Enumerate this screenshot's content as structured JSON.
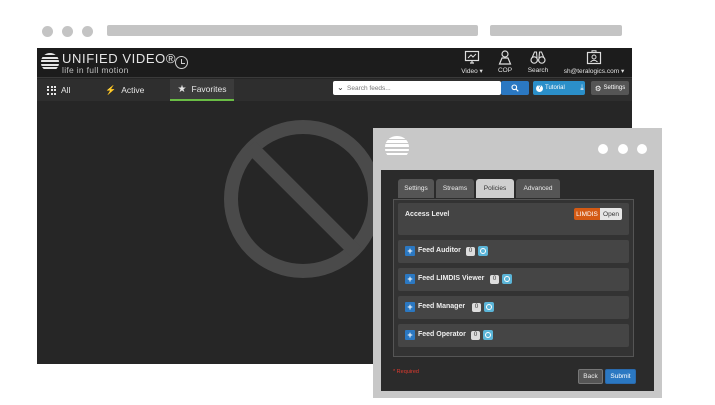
{
  "app": {
    "brand_title": "UNIFIED VIDEO®",
    "brand_tagline": "life in full motion",
    "nav": [
      {
        "label": "Video",
        "icon": "monitor-icon",
        "caret": "▾"
      },
      {
        "label": "COP",
        "icon": "person-icon",
        "caret": ""
      },
      {
        "label": "Search",
        "icon": "binoculars-icon",
        "caret": ""
      },
      {
        "label": "sh@teralogics.com",
        "icon": "user-badge-icon",
        "caret": "▾"
      }
    ],
    "tabs": [
      {
        "label": "All",
        "icon": "grid-icon"
      },
      {
        "label": "Active",
        "icon": "bolt-icon"
      },
      {
        "label": "Favorites",
        "icon": "star-icon"
      }
    ],
    "active_tab": "Favorites",
    "search_placeholder": "Search feeds...",
    "tutorial_label": "Tutorial",
    "settings_label": "Settings",
    "empty_state_icon": "no-symbol-icon"
  },
  "dialog": {
    "tabs": [
      "Settings",
      "Streams",
      "Policies",
      "Advanced"
    ],
    "active_tab": "Policies",
    "access_level": {
      "label": "Access Level",
      "options": [
        "LIMDIS",
        "Open"
      ],
      "selected": "LIMDIS"
    },
    "policies": [
      {
        "name": "Feed Auditor",
        "count": "0"
      },
      {
        "name": "Feed LIMDIS Viewer",
        "count": "0"
      },
      {
        "name": "Feed Manager",
        "count": "0"
      },
      {
        "name": "Feed Operator",
        "count": "0"
      }
    ],
    "required_note": "* Required",
    "back_label": "Back",
    "submit_label": "Submit"
  },
  "colors": {
    "accent_blue": "#2b78c2",
    "active_tab_underline": "#6abd45",
    "limdis_orange": "#d45a14",
    "required_red": "#e03a2e"
  }
}
